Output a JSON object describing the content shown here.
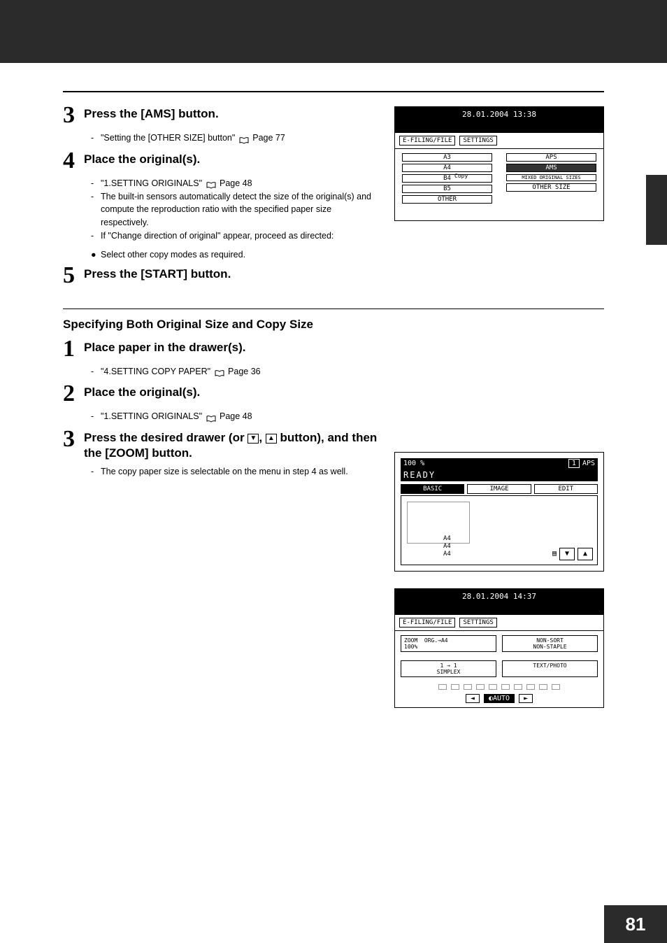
{
  "steps_a": {
    "s3": {
      "num": "3",
      "title": "Press the [AMS] button."
    },
    "s3_sub1": "\"Setting the [OTHER SIZE] button\"",
    "s3_sub1_page": "Page 77",
    "s4": {
      "num": "4",
      "title": "Place the original(s)."
    },
    "s4_sub1": "\"1.SETTING ORIGINALS\"",
    "s4_sub1_page": "Page 48",
    "s4_sub2": "The built-in sensors automatically detect the size of the original(s) and compute the reproduction ratio with the specified paper size respectively.",
    "s4_sub3": "If \"Change direction of original\" appear, proceed as directed:",
    "s4_bullet": "Select other copy modes as required.",
    "s5": {
      "num": "5",
      "title": "Press the [START] button."
    }
  },
  "section2_heading": "Specifying Both Original Size and Copy Size",
  "steps_b": {
    "s1": {
      "num": "1",
      "title": "Place paper in the drawer(s)."
    },
    "s1_sub1": "\"4.SETTING COPY PAPER\"",
    "s1_sub1_page": "Page 36",
    "s2": {
      "num": "2",
      "title": "Place the original(s)."
    },
    "s2_sub1": "\"1.SETTING ORIGINALS\"",
    "s2_sub1_page": "Page 48",
    "s3": {
      "num": "3",
      "title_pre": "Press the desired drawer (or ",
      "title_post": " button), and then the [ZOOM] button."
    },
    "s3_sub1": "The copy paper size is selectable on the menu in step 4 as well."
  },
  "scr1": {
    "date": "28.01.2004 13:38",
    "tab1": "E-FILING/FILE",
    "tab2": "SETTINGS",
    "left": [
      "A3",
      "A4",
      "B4",
      "B5",
      "OTHER"
    ],
    "right": [
      "APS",
      "AMS",
      "MIXED ORIGINAL SIZES",
      "OTHER SIZE"
    ],
    "copy": "Copy"
  },
  "scr2": {
    "zoom": "100 %",
    "count": "1",
    "aps": "APS",
    "status": "READY",
    "tabs": [
      "BASIC",
      "IMAGE",
      "EDIT"
    ],
    "trays": [
      "A4",
      "A4",
      "A4"
    ]
  },
  "scr3": {
    "date": "28.01.2004 14:37",
    "tab1": "E-FILING/FILE",
    "tab2": "SETTINGS",
    "zoom_label": "ZOOM",
    "org": "ORG.→A4",
    "pct": "100%",
    "sort": "NON-SORT\nNON-STAPLE",
    "simplex": "1 → 1\nSIMPLEX",
    "mode": "TEXT/PHOTO",
    "auto": "AUTO"
  },
  "icons": {
    "down": "▼",
    "up": "▲",
    "left": "◄",
    "right": "►"
  },
  "page_number": "81"
}
